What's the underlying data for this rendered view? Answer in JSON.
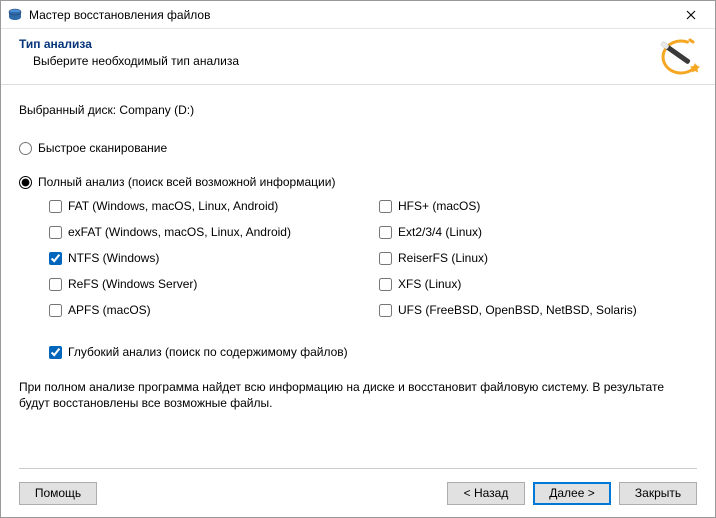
{
  "window": {
    "title": "Мастер восстановления файлов"
  },
  "header": {
    "heading": "Тип анализа",
    "sub": "Выберите необходимый тип анализа"
  },
  "disk": {
    "label_prefix": "Выбранный диск:",
    "value": "Company (D:)"
  },
  "scan": {
    "quick_label": "Быстрое сканирование",
    "full_label": "Полный анализ (поиск всей возможной информации)",
    "selected": "full"
  },
  "filesystems": {
    "left": [
      {
        "key": "fat",
        "label": "FAT (Windows, macOS, Linux, Android)",
        "checked": false
      },
      {
        "key": "exfat",
        "label": "exFAT (Windows, macOS, Linux, Android)",
        "checked": false
      },
      {
        "key": "ntfs",
        "label": "NTFS (Windows)",
        "checked": true
      },
      {
        "key": "refs",
        "label": "ReFS (Windows Server)",
        "checked": false
      },
      {
        "key": "apfs",
        "label": "APFS (macOS)",
        "checked": false
      }
    ],
    "right": [
      {
        "key": "hfs",
        "label": "HFS+ (macOS)",
        "checked": false
      },
      {
        "key": "ext",
        "label": "Ext2/3/4 (Linux)",
        "checked": false
      },
      {
        "key": "reiser",
        "label": "ReiserFS (Linux)",
        "checked": false
      },
      {
        "key": "xfs",
        "label": "XFS (Linux)",
        "checked": false
      },
      {
        "key": "ufs",
        "label": "UFS (FreeBSD, OpenBSD, NetBSD, Solaris)",
        "checked": false
      }
    ]
  },
  "deep": {
    "label": "Глубокий анализ (поиск по содержимому файлов)",
    "checked": true
  },
  "description": "При полном анализе программа найдет всю информацию на диске и восстановит файловую систему. В результате будут восстановлены все возможные файлы.",
  "buttons": {
    "help": "Помощь",
    "back": "< Назад",
    "next": "Далее >",
    "close": "Закрыть"
  }
}
